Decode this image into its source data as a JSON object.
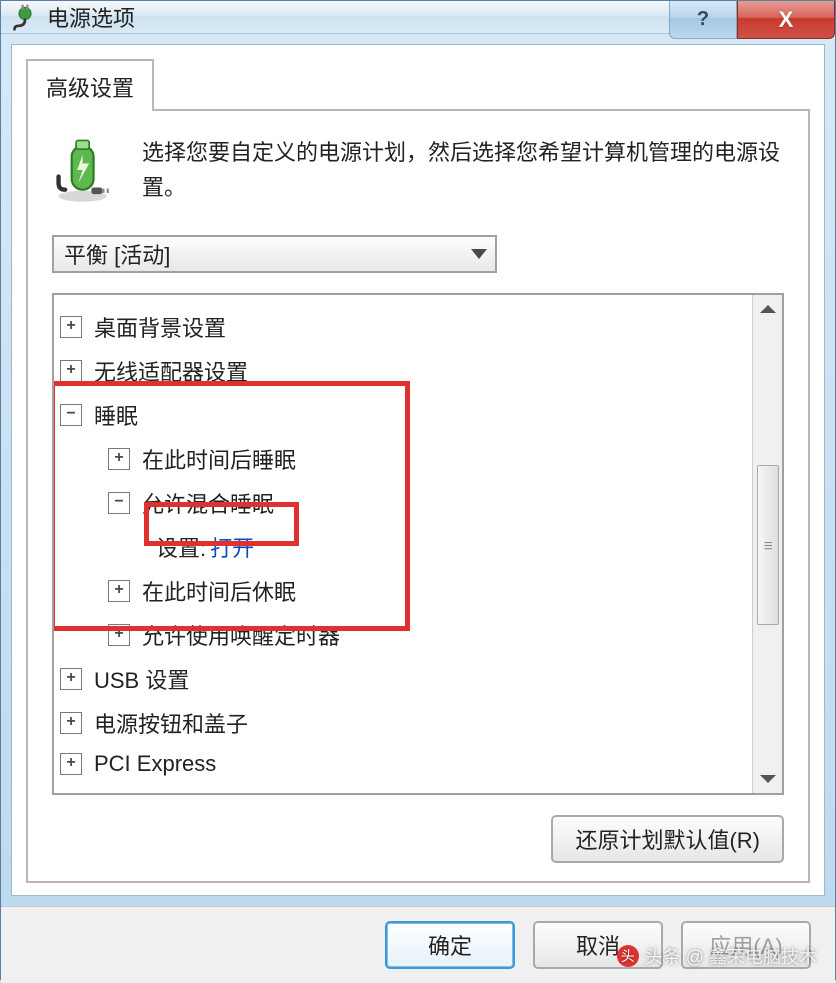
{
  "window": {
    "title": "电源选项",
    "help_symbol": "?",
    "close_symbol": "X"
  },
  "tab": {
    "label": "高级设置"
  },
  "intro": "选择您要自定义的电源计划，然后选择您希望计算机管理的电源设置。",
  "plan_select": {
    "value": "平衡 [活动]"
  },
  "tree": {
    "desktop_bg": "桌面背景设置",
    "wireless": "无线适配器设置",
    "sleep": "睡眠",
    "sleep_after": "在此时间后睡眠",
    "hybrid_sleep": "允许混合睡眠",
    "setting_label": "设置:",
    "setting_value": "打开",
    "hibernate_after": "在此时间后休眠",
    "wake_timers": "允许使用唤醒定时器",
    "usb": "USB 设置",
    "power_buttons": "电源按钮和盖子",
    "pci": "PCI Express"
  },
  "scroll_thumb_label": "III",
  "buttons": {
    "restore": "还原计划默认值(R)",
    "ok": "确定",
    "cancel": "取消",
    "apply": "应用(A)"
  },
  "watermark": "头条 @ 鑫荣电脑技术",
  "colors": {
    "highlight": "#e03030",
    "link": "#0a4ec2",
    "close_bg": "#c83a2e"
  }
}
